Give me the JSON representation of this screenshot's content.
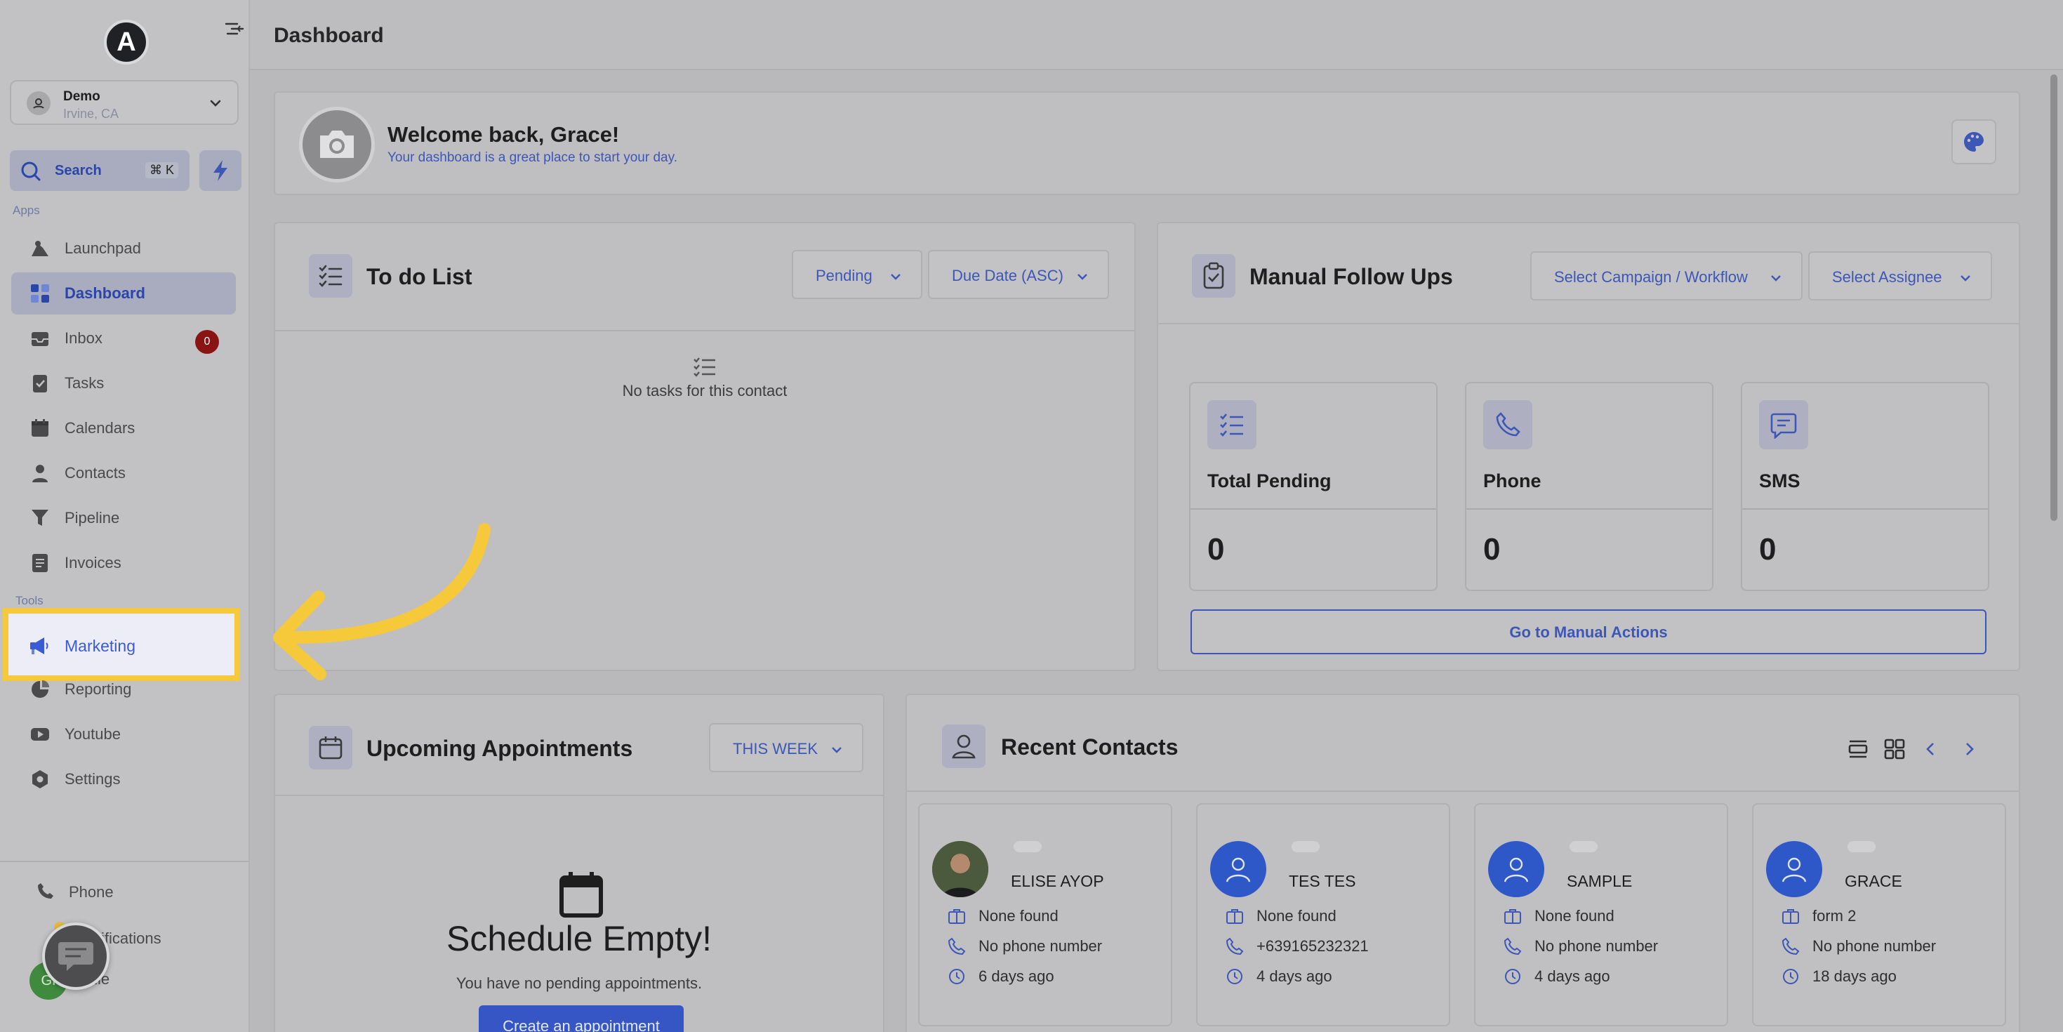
{
  "sidebar": {
    "logo_letter": "A",
    "location": {
      "name": "Demo",
      "address": "Irvine, CA"
    },
    "search": {
      "label": "Search",
      "shortcut": "⌘ K"
    },
    "apps_section": "Apps",
    "tools_section": "Tools",
    "apps": [
      {
        "label": "Launchpad",
        "icon": "rocket-icon"
      },
      {
        "label": "Dashboard",
        "icon": "dashboard-icon",
        "active": true
      },
      {
        "label": "Inbox",
        "icon": "inbox-icon",
        "badge": "0"
      },
      {
        "label": "Tasks",
        "icon": "tasks-icon"
      },
      {
        "label": "Calendars",
        "icon": "calendar-icon"
      },
      {
        "label": "Contacts",
        "icon": "contacts-icon"
      },
      {
        "label": "Pipeline",
        "icon": "pipeline-icon"
      },
      {
        "label": "Invoices",
        "icon": "invoice-icon"
      }
    ],
    "tools": [
      {
        "label": "Marketing",
        "icon": "megaphone-icon",
        "highlighted": true
      },
      {
        "label": "Reporting",
        "icon": "reporting-icon"
      },
      {
        "label": "Youtube",
        "icon": "youtube-icon"
      },
      {
        "label": "Settings",
        "icon": "settings-icon"
      }
    ],
    "bottom": [
      {
        "label": "Phone",
        "icon": "phone-icon"
      },
      {
        "label": "ifications",
        "icon": "bell-icon"
      },
      {
        "label": "file",
        "icon": "profile-icon"
      }
    ],
    "avatar_initials": "GI"
  },
  "header": {
    "title": "Dashboard"
  },
  "welcome": {
    "title": "Welcome back, Grace!",
    "subtitle": "Your dashboard is a great place to start your day."
  },
  "todo": {
    "title": "To do List",
    "status_filter": "Pending",
    "sort_filter": "Due Date (ASC)",
    "empty": "No tasks for this contact"
  },
  "followups": {
    "title": "Manual Follow Ups",
    "campaign_filter": "Select Campaign / Workflow",
    "assignee_filter": "Select Assignee",
    "stats": [
      {
        "label": "Total Pending",
        "value": "0",
        "icon": "checklist-icon"
      },
      {
        "label": "Phone",
        "value": "0",
        "icon": "phone-icon"
      },
      {
        "label": "SMS",
        "value": "0",
        "icon": "sms-icon"
      }
    ],
    "action_button": "Go to Manual Actions"
  },
  "appointments": {
    "title": "Upcoming Appointments",
    "range_filter": "THIS WEEK",
    "empty_title": "Schedule Empty!",
    "empty_subtitle": "You have no pending appointments.",
    "create_button": "Create an appointment"
  },
  "recent_contacts": {
    "title": "Recent Contacts",
    "contacts": [
      {
        "name": "ELISE AYOP",
        "company": "None found",
        "phone": "No phone number",
        "last_seen": "6 days ago",
        "photo": true
      },
      {
        "name": "TES TES",
        "company": "None found",
        "phone": "+639165232321",
        "last_seen": "4 days ago",
        "photo": false
      },
      {
        "name": "SAMPLE",
        "company": "None found",
        "phone": "No phone number",
        "last_seen": "4 days ago",
        "photo": false
      },
      {
        "name": "GRACE",
        "company": "form 2",
        "phone": "No phone number",
        "last_seen": "18 days ago",
        "photo": false
      }
    ]
  },
  "colors": {
    "accent": "#3d57b6",
    "highlight": "#f6c93a",
    "badge": "#8a1414"
  }
}
